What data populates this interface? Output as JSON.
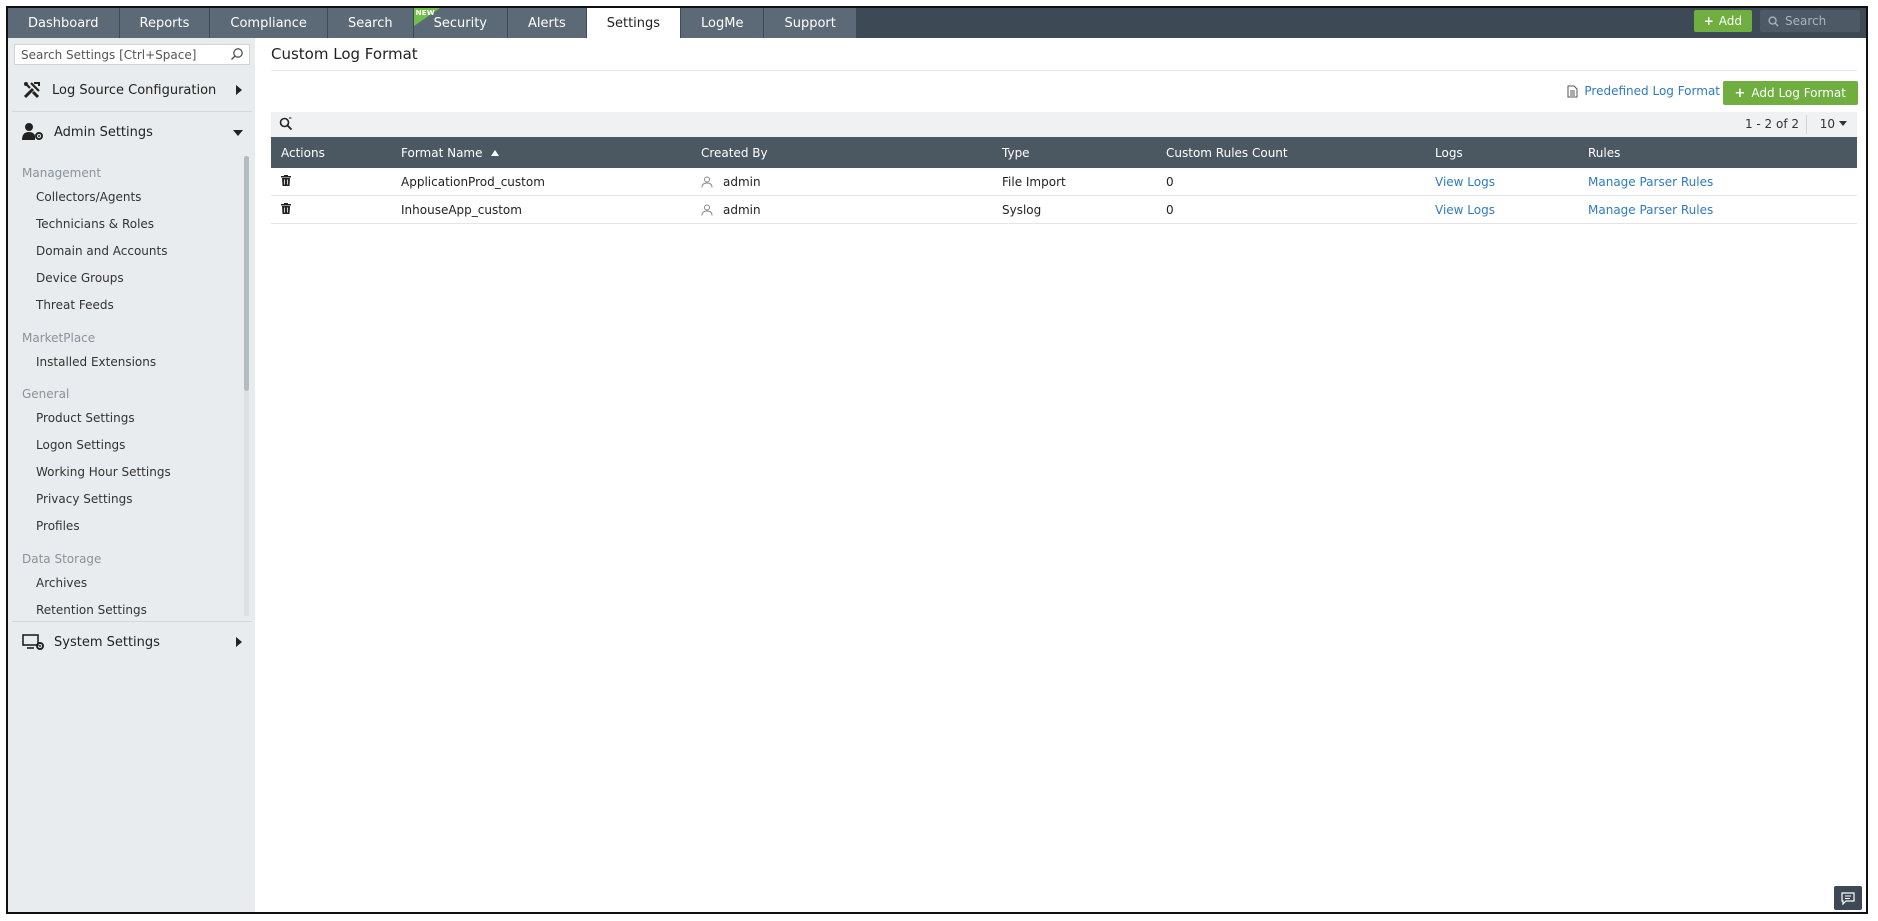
{
  "nav": {
    "tabs": [
      {
        "label": "Dashboard"
      },
      {
        "label": "Reports"
      },
      {
        "label": "Compliance"
      },
      {
        "label": "Search"
      },
      {
        "label": "Security",
        "badge": "NEW"
      },
      {
        "label": "Alerts"
      },
      {
        "label": "Settings",
        "active": true
      },
      {
        "label": "LogMe"
      },
      {
        "label": "Support"
      }
    ],
    "add_label": "Add",
    "search_placeholder": "Search"
  },
  "sidebar": {
    "search_placeholder": "Search Settings [Ctrl+Space]",
    "log_source": "Log Source Configuration",
    "admin_settings": "Admin Settings",
    "system_settings": "System Settings",
    "groups": [
      {
        "label": "Management",
        "items": [
          "Collectors/Agents",
          "Technicians & Roles",
          "Domain and Accounts",
          "Device Groups",
          "Threat Feeds"
        ]
      },
      {
        "label": "MarketPlace",
        "items": [
          "Installed Extensions"
        ]
      },
      {
        "label": "General",
        "items": [
          "Product Settings",
          "Logon Settings",
          "Working Hour Settings",
          "Privacy Settings",
          "Profiles"
        ]
      },
      {
        "label": "Data Storage",
        "items": [
          "Archives",
          "Retention Settings"
        ]
      }
    ]
  },
  "main": {
    "title": "Custom Log Format",
    "predefined_link": "Predefined Log Format",
    "add_button": "Add Log Format",
    "pagination": "1 - 2 of 2",
    "per_page": "10",
    "columns": [
      "Actions",
      "Format Name",
      "Created By",
      "Type",
      "Custom Rules Count",
      "Logs",
      "Rules"
    ],
    "rows": [
      {
        "format_name": "ApplicationProd_custom",
        "created_by": "admin",
        "type": "File Import",
        "custom_rules_count": "0",
        "logs": "View Logs",
        "rules": "Manage Parser Rules"
      },
      {
        "format_name": "InhouseApp_custom",
        "created_by": "admin",
        "type": "Syslog",
        "custom_rules_count": "0",
        "logs": "View Logs",
        "rules": "Manage Parser Rules"
      }
    ]
  },
  "colors": {
    "topbar": "#3d4a55",
    "tab": "#5b6a76",
    "accent_green": "#6fae3f",
    "link_blue": "#2f7bbd",
    "table_header": "#4b5862"
  }
}
